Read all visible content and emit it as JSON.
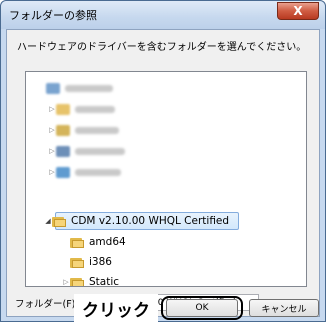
{
  "window": {
    "title": "フォルダーの参照",
    "close_label": "X"
  },
  "instruction": "ハードウェアのドライバーを含むフォルダーを選んでください。",
  "tree": {
    "selected": "CDM v2.10.00 WHQL Certified",
    "children": [
      "amd64",
      "i386",
      "Static"
    ]
  },
  "folder": {
    "label": "フォルダー(F):",
    "value": "CDM v2.10.00 WHQL Certified"
  },
  "buttons": {
    "ok": "OK",
    "cancel": "キャンセル"
  },
  "annotation": "クリック"
}
